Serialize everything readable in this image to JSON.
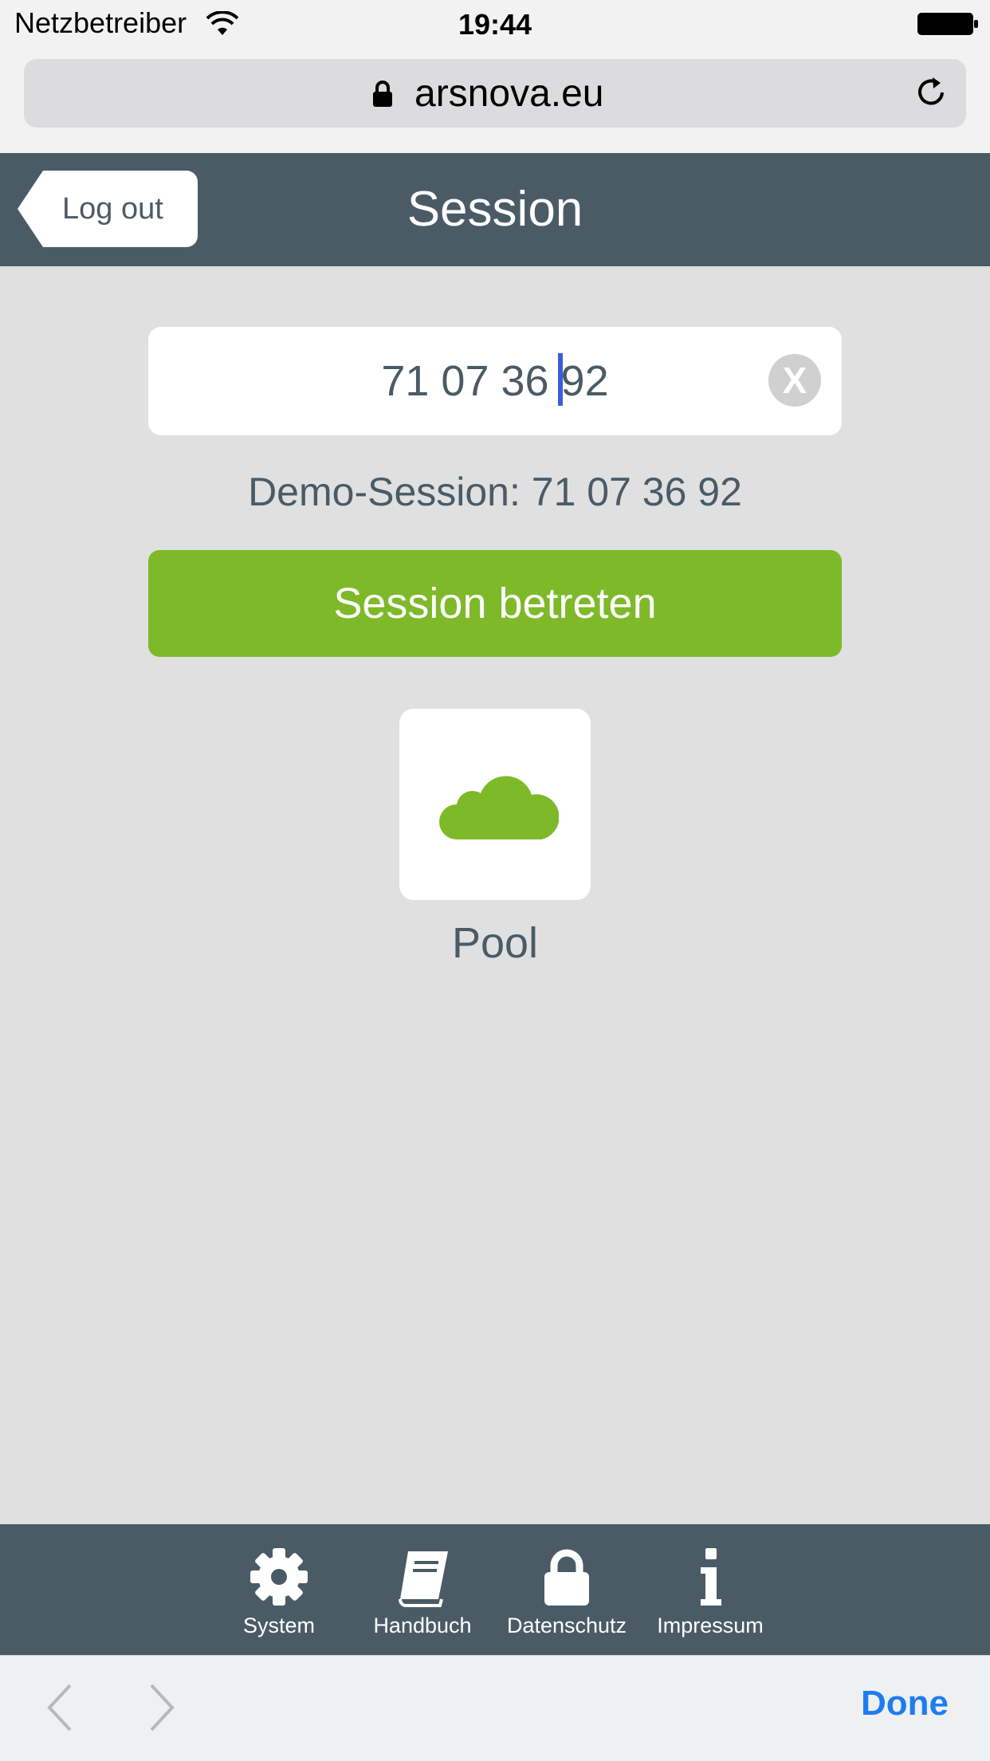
{
  "status_bar": {
    "carrier": "Netzbetreiber",
    "time": "19:44"
  },
  "browser": {
    "url": "arsnova.eu"
  },
  "header": {
    "logout_label": "Log out",
    "title": "Session"
  },
  "session": {
    "input_value": "71 07 36 92",
    "clear_label": "X",
    "demo_hint": "Demo-Session: 71 07 36 92",
    "join_label": "Session betreten"
  },
  "pool": {
    "label": "Pool",
    "icon": "cloud-icon"
  },
  "footer_nav": {
    "items": [
      {
        "label": "System",
        "icon": "gear-icon"
      },
      {
        "label": "Handbuch",
        "icon": "book-icon"
      },
      {
        "label": "Datenschutz",
        "icon": "lock-icon"
      },
      {
        "label": "Impressum",
        "icon": "info-icon"
      }
    ]
  },
  "keyboard_accessory": {
    "done_label": "Done"
  },
  "colors": {
    "header": "#4a5b66",
    "accent_green": "#7eb929",
    "background": "#e0e0e0",
    "done_blue": "#1f7cf0"
  }
}
